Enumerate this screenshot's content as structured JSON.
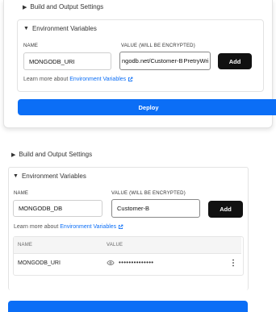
{
  "top_panel": {
    "build_section_title": "Build and Output Settings",
    "env_section_title": "Environment Variables",
    "name_label": "NAME",
    "value_label": "VALUE (WILL BE ENCRYPTED)",
    "name_value": "MONGODB_URI",
    "value_before_cursor": "ngodb.net/Customer-B",
    "value_after_cursor": "PretryWri",
    "add_button": "Add",
    "learn_prefix": "Learn more about",
    "learn_link": "Environment Variables",
    "deploy_button": "Deploy"
  },
  "bottom_panel": {
    "build_section_title": "Build and Output Settings",
    "env_section_title": "Environment Variables",
    "name_label": "NAME",
    "value_label": "VALUE (WILL BE ENCRYPTED)",
    "name_value": "MONGODB_DB",
    "value_value": "Customer-B",
    "add_button": "Add",
    "learn_prefix": "Learn more about",
    "learn_link": "Environment Variables",
    "table": {
      "headers": [
        "NAME",
        "VALUE"
      ],
      "rows": [
        {
          "name": "MONGODB_URI",
          "value": "••••••••••••••"
        }
      ]
    }
  },
  "icons": {
    "triangle_right": "▶",
    "triangle_down": "▼",
    "external_link": "external-link-icon",
    "eye": "eye-icon",
    "more": "more-vertical-icon"
  }
}
